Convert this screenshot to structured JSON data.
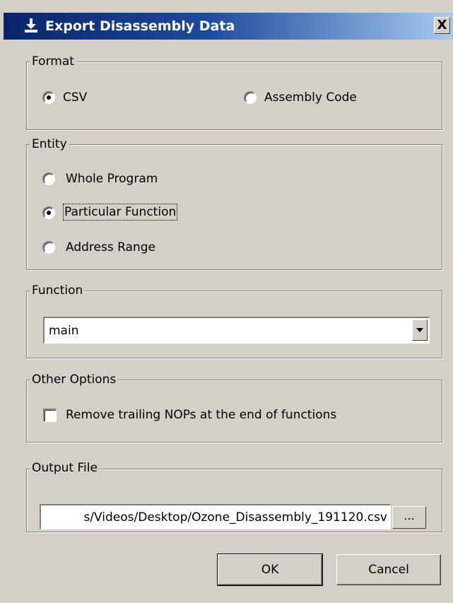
{
  "window": {
    "title": "Export Disassembly Data",
    "close_glyph": "X",
    "icon": "download-icon"
  },
  "format": {
    "legend": "Format",
    "options": [
      {
        "label": "CSV",
        "checked": true
      },
      {
        "label": "Assembly Code",
        "checked": false
      }
    ]
  },
  "entity": {
    "legend": "Entity",
    "options": [
      {
        "label": "Whole Program",
        "checked": false
      },
      {
        "label": "Particular Function",
        "checked": true
      },
      {
        "label": "Address Range",
        "checked": false
      }
    ]
  },
  "function": {
    "legend": "Function",
    "selected": "main"
  },
  "other_options": {
    "legend": "Other Options",
    "remove_trailing_nops": {
      "label": "Remove trailing NOPs at the end of functions",
      "checked": false
    }
  },
  "output_file": {
    "legend": "Output File",
    "value": "s/Videos/Desktop/Ozone_Disassembly_191120.csv",
    "browse_label": "..."
  },
  "buttons": {
    "ok": "OK",
    "cancel": "Cancel"
  },
  "colors": {
    "dialog_bg": "#d4d0c8",
    "title_gradient_start": "#0a246a",
    "title_gradient_end": "#a6caf0"
  }
}
